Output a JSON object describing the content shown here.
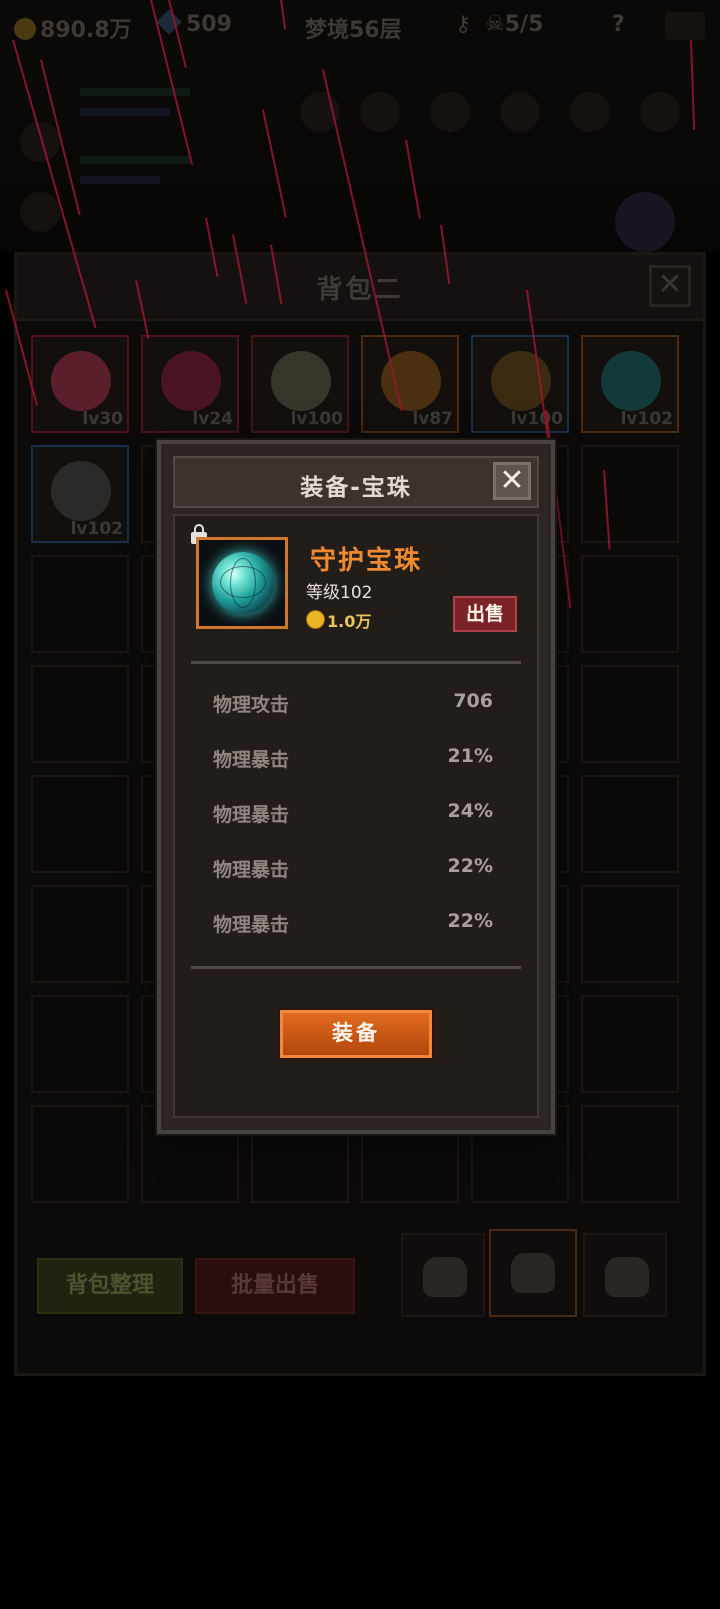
{
  "topbar": {
    "gold": "890.8万",
    "gems": "509",
    "floor": "梦境56层",
    "skull": "5/5",
    "help": "?"
  },
  "bag": {
    "title": "背包二",
    "close": "✕",
    "slots": [
      {
        "level": "lv30",
        "border": "red",
        "icon_color": "#5a1f2a"
      },
      {
        "level": "lv24",
        "border": "red",
        "icon_color": "#4a1420"
      },
      {
        "level": "lv100",
        "border": "red",
        "icon_color": "#38352a"
      },
      {
        "level": "lv87",
        "border": "orange",
        "icon_color": "#4a3010"
      },
      {
        "level": "lv100",
        "border": "blue",
        "icon_color": "#3a2a10"
      },
      {
        "level": "lv102",
        "border": "orange",
        "icon_color": "#14393b"
      },
      {
        "level": "lv102",
        "border": "blue",
        "icon_color": "#2b2a28"
      }
    ],
    "sort_button": "背包整理",
    "batch_sell_button": "批量出售"
  },
  "modal": {
    "title": "装备-宝珠",
    "close": "✕",
    "item_name": "守护宝珠",
    "item_level": "等级102",
    "price": "1.0万",
    "sell_button": "出售",
    "stats": [
      {
        "name": "物理攻击",
        "value": "706"
      },
      {
        "name": "物理暴击",
        "value": "21%"
      },
      {
        "name": "物理暴击",
        "value": "24%"
      },
      {
        "name": "物理暴击",
        "value": "22%"
      },
      {
        "name": "物理暴击",
        "value": "22%"
      }
    ],
    "equip_button": "装备"
  },
  "colors": {
    "accent": "#f08a31",
    "rain": "#9b1630",
    "equip_button": "#d4621a",
    "sell_button": "#7a2226"
  }
}
